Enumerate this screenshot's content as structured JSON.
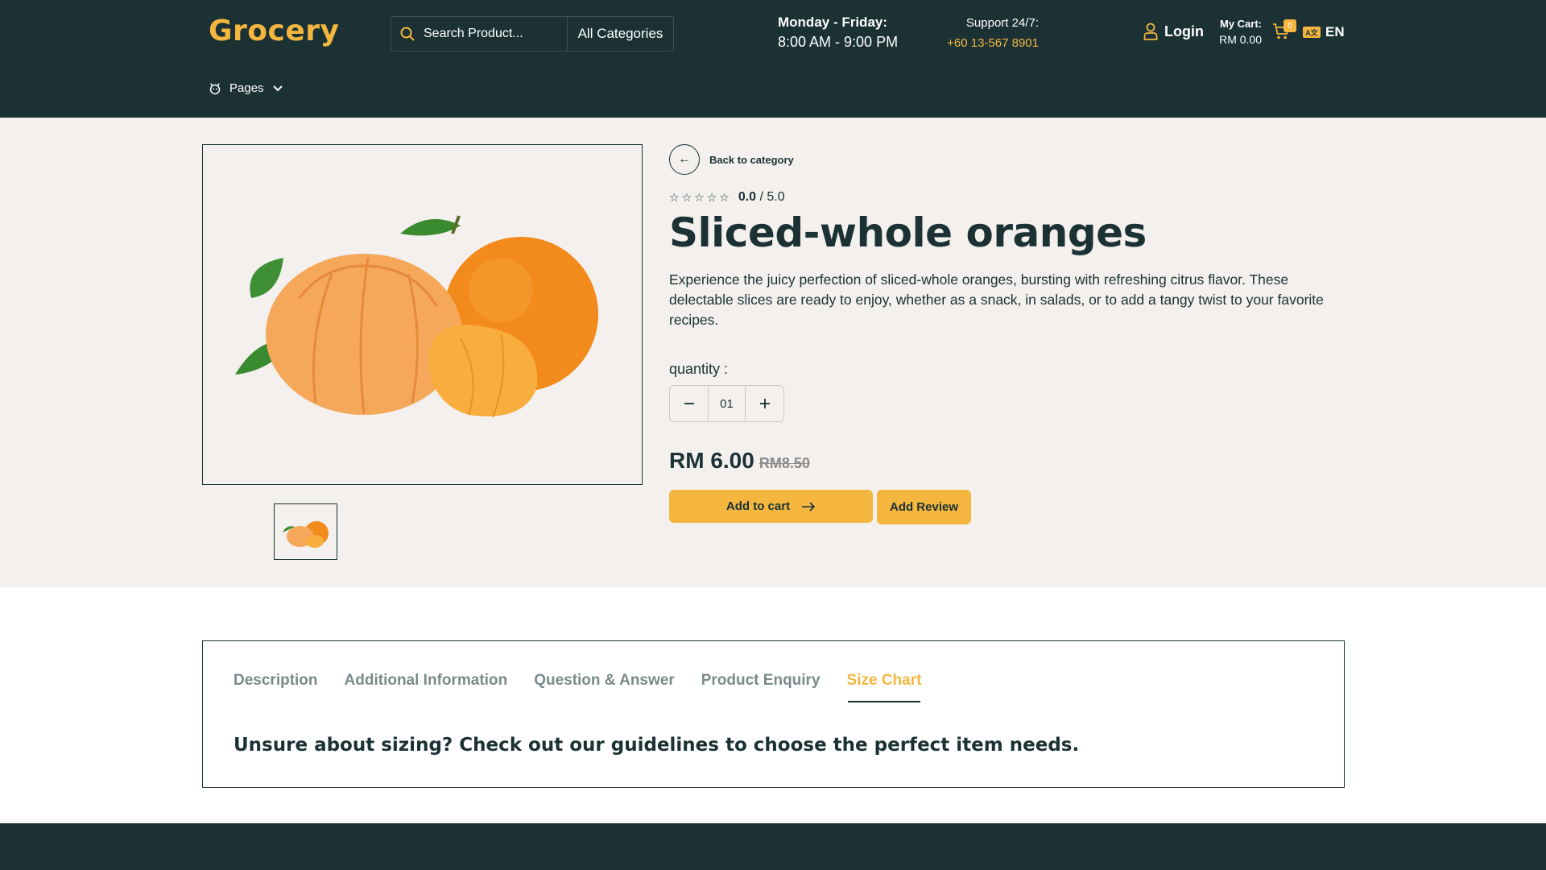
{
  "header": {
    "logo": "Grocery",
    "search_placeholder": "Search Product...",
    "category": "All Categories",
    "hours_title": "Monday - Friday:",
    "hours_value": "8:00 AM - 9:00 PM",
    "support_title": "Support 24/7:",
    "support_phone": "+60 13-567 8901",
    "login": "Login",
    "cart_title": "My Cart:",
    "cart_total": "RM 0.00",
    "cart_count": "0",
    "language": "EN",
    "pages_menu": "Pages"
  },
  "product": {
    "back_label": "Back to category",
    "rating_value": "0.0",
    "rating_max": "/ 5.0",
    "title": "Sliced-whole oranges",
    "description": "Experience the juicy perfection of sliced-whole oranges, bursting with refreshing citrus flavor. These delectable slices are ready to enjoy, whether as a snack, in salads, or to add a tangy twist to your favorite recipes.",
    "quantity_label": "quantity :",
    "quantity_value": "01",
    "price": "RM 6.00",
    "old_price": "RM8.50",
    "add_to_cart": "Add to cart",
    "add_review": "Add Review"
  },
  "tabs": {
    "items": [
      "Description",
      "Additional Information",
      "Question & Answer",
      "Product Enquiry",
      "Size Chart"
    ],
    "active": "Size Chart",
    "content": "Unsure about sizing? Check out our guidelines to choose the perfect item needs."
  },
  "colors": {
    "primary": "#1b3133",
    "accent": "#f4b63f",
    "section_bg": "#f3f0ee"
  }
}
